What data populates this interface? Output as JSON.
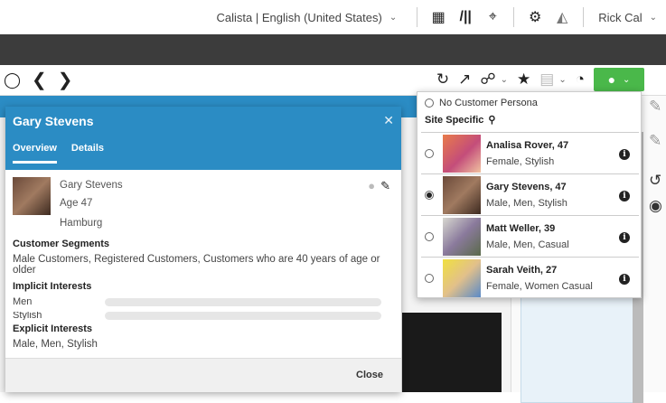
{
  "topbar": {
    "locale": "Calista | English (United States)",
    "user": "Rick Cal"
  },
  "modal": {
    "title": "Gary Stevens",
    "tabs": [
      "Overview",
      "Details"
    ],
    "profile": {
      "name": "Gary Stevens",
      "age": "Age 47",
      "city": "Hamburg"
    },
    "segments_heading": "Customer Segments",
    "segments_text": "Male Customers, Registered Customers, Customers who are 40 years of age or older",
    "implicit_heading": "Implicit Interests",
    "implicit": [
      {
        "label": "Men",
        "level": 0
      },
      {
        "label": "Stylish",
        "level": 0
      }
    ],
    "explicit_heading": "Explicit Interests",
    "explicit_text": "Male, Men, Stylish",
    "close_label": "Close"
  },
  "dropdown": {
    "no_persona": "No Customer Persona",
    "site_specific": "Site Specific",
    "personas": [
      {
        "name": "Analisa Rover, 47",
        "desc": "Female, Stylish",
        "selected": false
      },
      {
        "name": "Gary Stevens, 47",
        "desc": "Male, Men, Stylish",
        "selected": true
      },
      {
        "name": "Matt Weller, 39",
        "desc": "Male, Men, Casual",
        "selected": false
      },
      {
        "name": "Sarah Veith, 27",
        "desc": "Female, Women Casual",
        "selected": false
      }
    ]
  },
  "colors": {
    "accent": "#2b8cc4",
    "persona_green": "#4ab84a",
    "dark": "#3c3c3c"
  }
}
